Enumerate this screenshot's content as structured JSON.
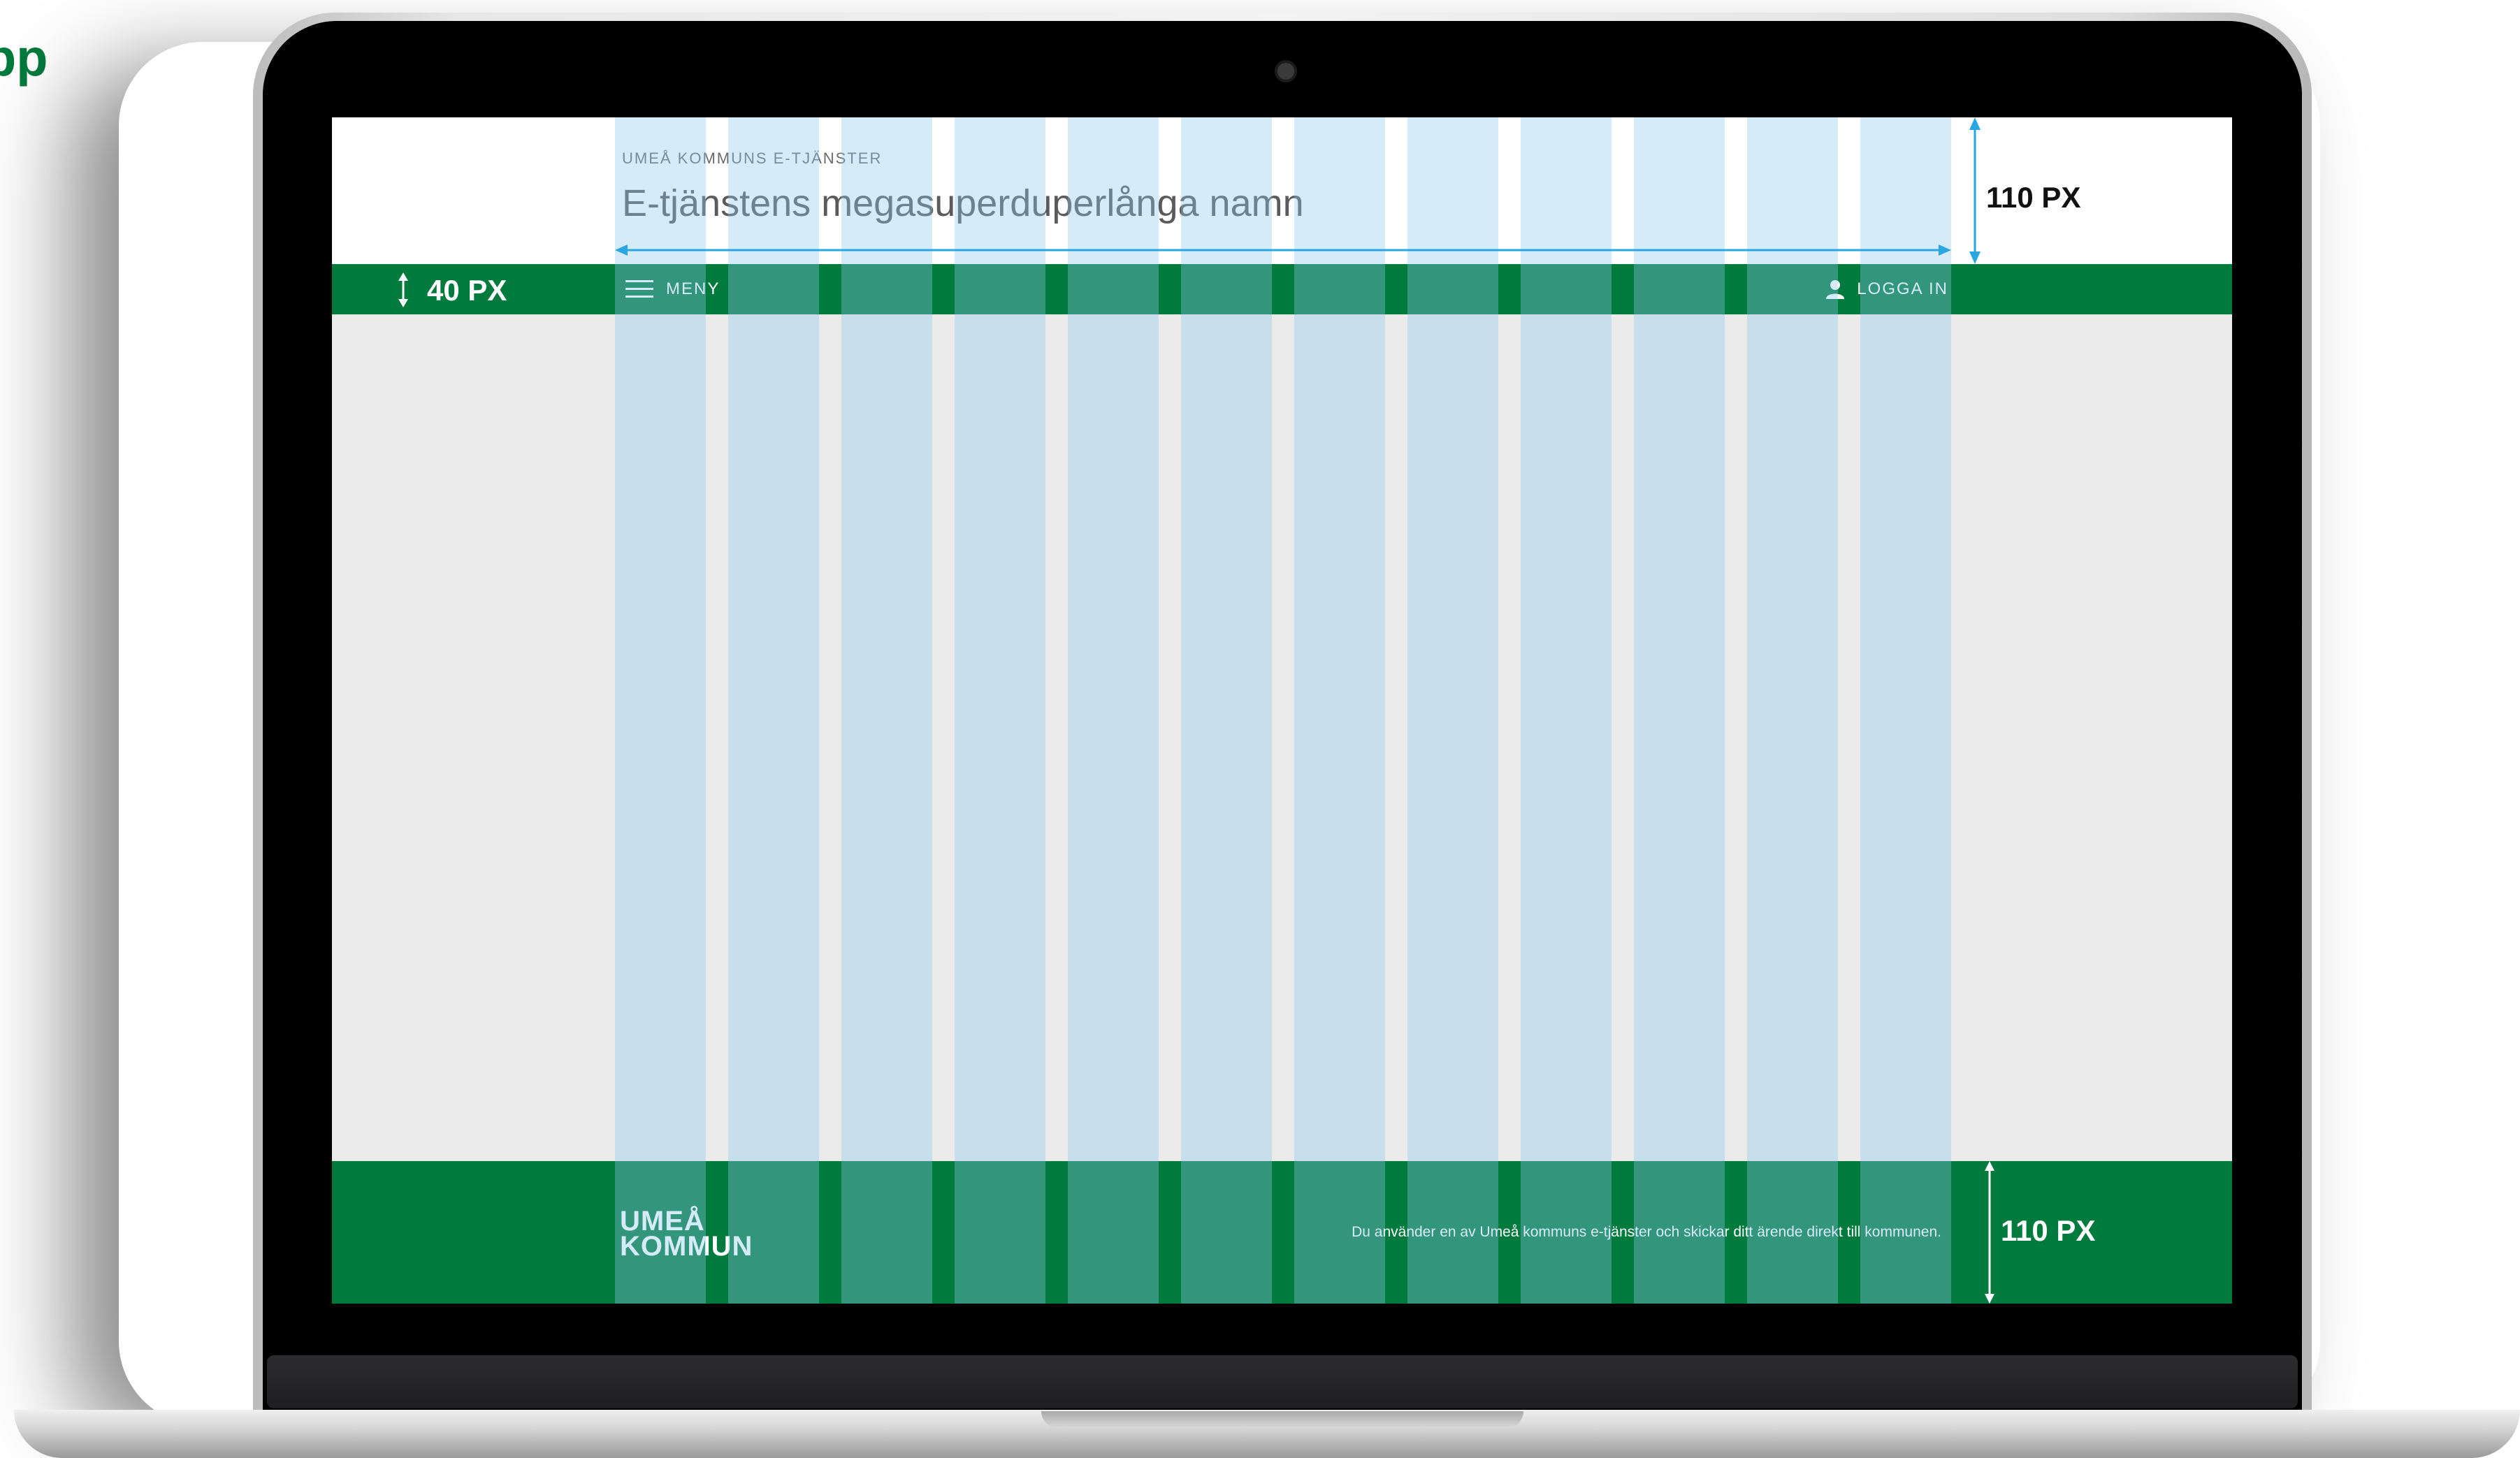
{
  "corner_label": "pp",
  "app": {
    "subtitle": "UMEÅ KOMMUNS E-TJÄNSTER",
    "title": "E-tjänstens megasuperduperlånga namn"
  },
  "nav": {
    "menu_label": "MENY",
    "menu_icon": "hamburger-icon",
    "login_label": "LOGGA IN",
    "login_icon": "user-icon"
  },
  "footer": {
    "logo_line1": "UMEÅ",
    "logo_line2": "KOMMUN",
    "text": "Du använder en av Umeå kommuns e-tjänster och skickar ditt ärende direkt till kommunen."
  },
  "annotations": {
    "header_height": "110 PX",
    "nav_height": "40 PX",
    "footer_height": "110 PX"
  },
  "colors": {
    "brand_green": "#007a3d",
    "content_bg": "#ebebeb",
    "grid_overlay": "#8cc8eb",
    "annotation_line": "#2aa7e0"
  }
}
